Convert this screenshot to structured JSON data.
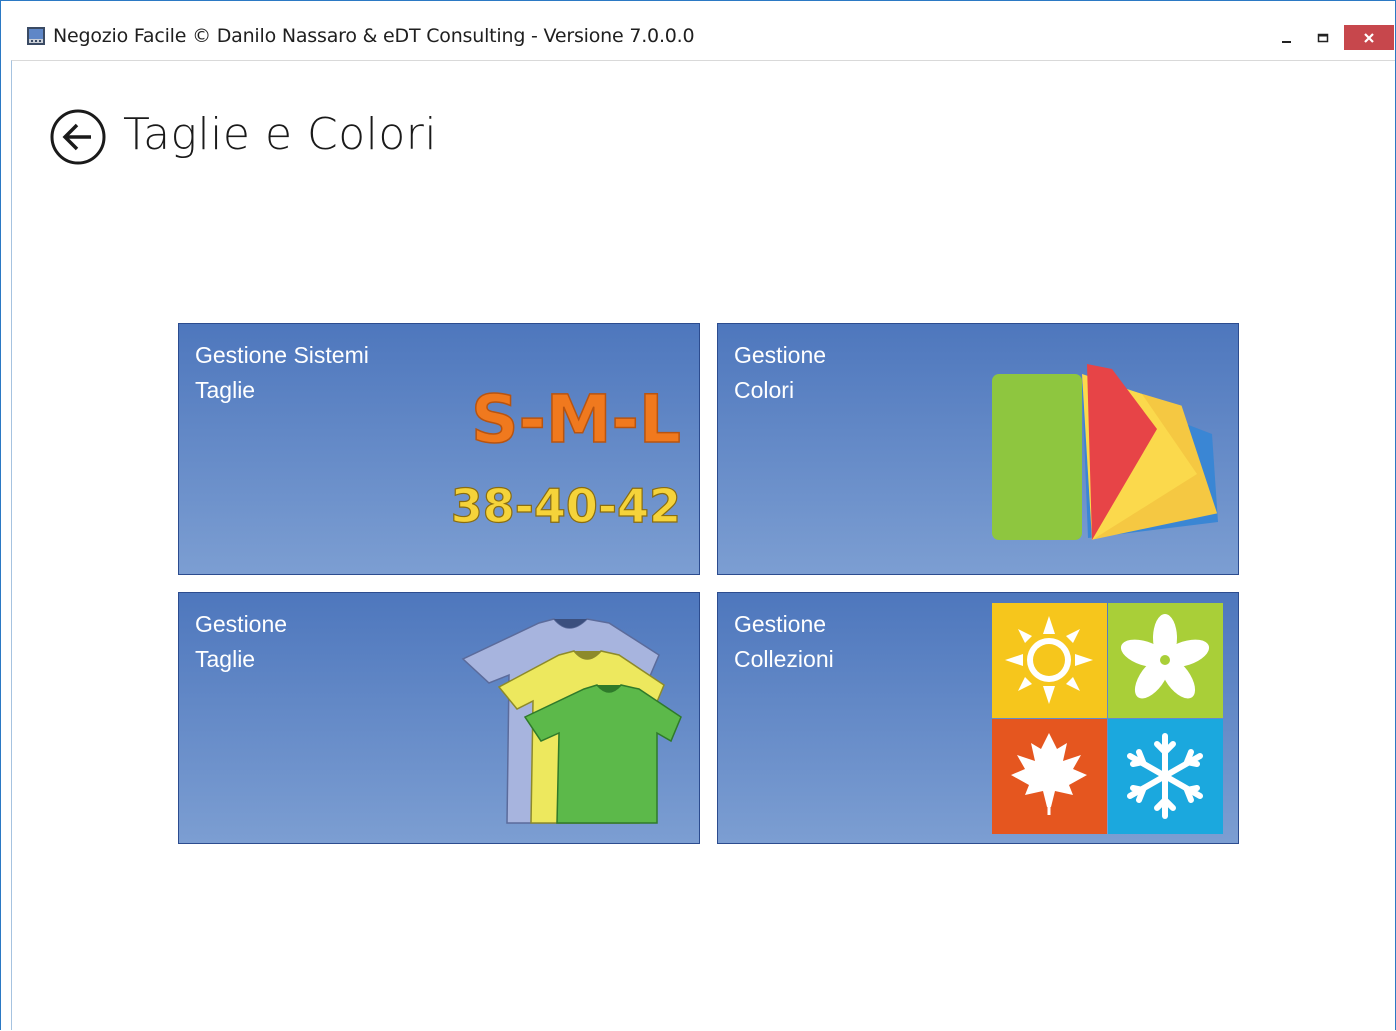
{
  "window": {
    "title": "Negozio Facile © Danilo Nassaro & eDT Consulting - Versione 7.0.0.0",
    "controls": {
      "minimize_icon": "minimize-icon",
      "maximize_icon": "maximize-icon",
      "close_icon": "close-icon"
    }
  },
  "page": {
    "title": "Taglie e Colori",
    "back_icon": "back-arrow-icon"
  },
  "tiles": [
    {
      "line1": "Gestione Sistemi",
      "line2": "Taglie",
      "art_text1": "S-M-L",
      "art_text2": "38-40-42",
      "icon": "size-systems-icon"
    },
    {
      "line1": "Gestione",
      "line2": "Colori",
      "icon": "color-swatches-icon"
    },
    {
      "line1": "Gestione",
      "line2": "Taglie",
      "icon": "tshirts-icon"
    },
    {
      "line1": "Gestione",
      "line2": "Collezioni",
      "icon": "seasons-icon"
    }
  ],
  "colors": {
    "tile_top": "#4e77bd",
    "tile_bottom": "#7c9ed2",
    "tile_border": "#2c4c8f",
    "close_button": "#c7474c"
  }
}
